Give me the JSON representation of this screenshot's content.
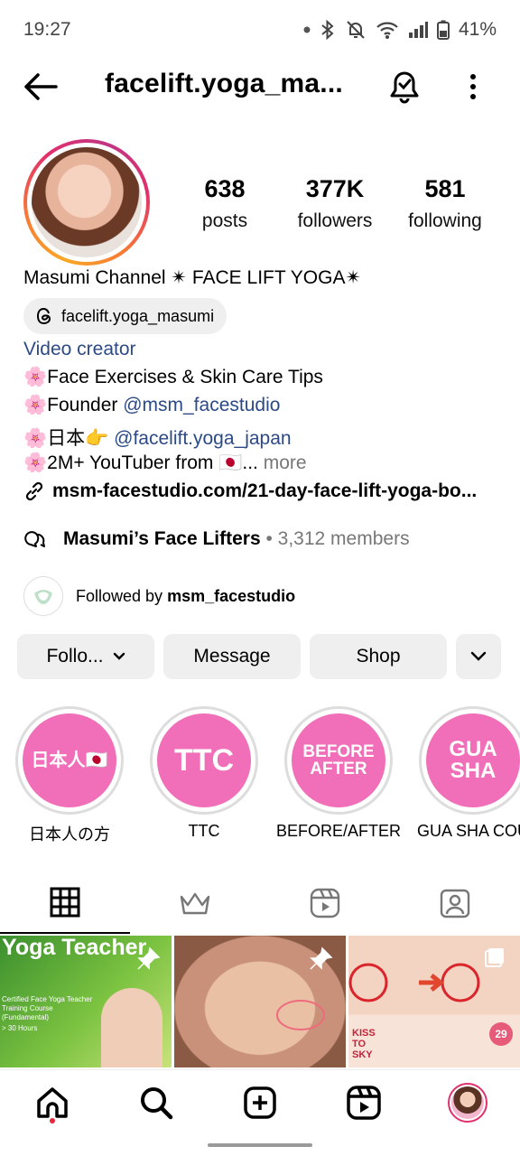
{
  "status_bar": {
    "time": "19:27",
    "battery": "41%"
  },
  "header": {
    "username": "facelift.yoga_ma..."
  },
  "profile": {
    "stats": [
      {
        "count": "638",
        "label": "posts"
      },
      {
        "count": "377K",
        "label": "followers"
      },
      {
        "count": "581",
        "label": "following"
      }
    ],
    "full_name": "Masumi Channel ✴ FACE LIFT YOGA✴",
    "threads_handle": "facelift.yoga_masumi",
    "category": "Video creator",
    "bio": {
      "line1": "🌸Face Exercises & Skin Care Tips",
      "line2_prefix": "🌸Founder ",
      "line2_mention": "@msm_facestudio",
      "line3_prefix": "🌸日本👉 ",
      "line3_mention": "@facelift.yoga_japan",
      "line4_text": "🌸2M+ YouTuber from 🇯🇵...",
      "line4_more": " more"
    },
    "link": "msm-facestudio.com/21-day-face-lift-yoga-bo..."
  },
  "community": {
    "name": "Masumi’s Face Lifters",
    "members": "• 3,312 members"
  },
  "followed_by": {
    "prefix": "Followed by ",
    "name": "msm_facestudio"
  },
  "actions": {
    "follow": "Follo...",
    "message": "Message",
    "shop": "Shop"
  },
  "highlights": [
    {
      "circle_text": "日本人🇯🇵",
      "label": "日本人の方"
    },
    {
      "circle_text": "TTC",
      "label": "TTC"
    },
    {
      "circle_text": "BEFORE AFTER",
      "label": "BEFORE/AFTER"
    },
    {
      "circle_text": "GUA SHA",
      "label": "GUA SHA COU"
    }
  ],
  "posts": [
    {
      "title": "Yoga Teacher",
      "subtitle": "Certified Face Yoga Teacher Training Course (Fundamental)",
      "note": "> 30 Hours"
    },
    {
      "title": ""
    },
    {
      "tag": "KISS TO SKY",
      "badge": "29"
    }
  ],
  "colors": {
    "link": "#2c4a86",
    "highlight_pink": "#f06fb8",
    "button_bg": "#efefef"
  }
}
